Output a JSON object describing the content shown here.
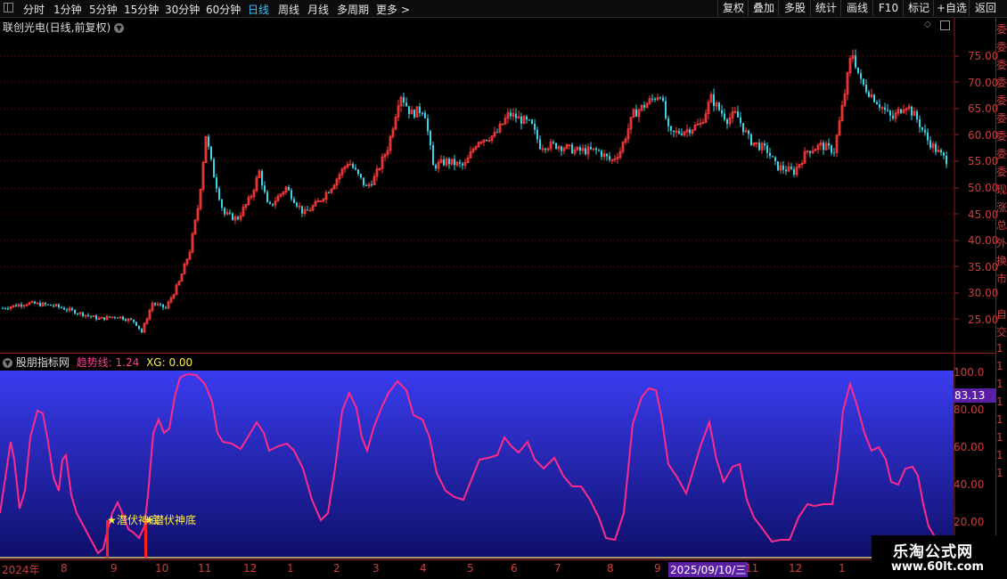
{
  "toolbar": {
    "periods": [
      "分时",
      "1分钟",
      "5分钟",
      "15分钟",
      "30分钟",
      "60分钟",
      "日线",
      "周线",
      "月线",
      "多周期",
      "更多 >"
    ],
    "active_period": "日线",
    "right_buttons": [
      "复权",
      "叠加",
      "多股",
      "统计",
      "画线",
      "F10",
      "标记",
      "+自选",
      "返回"
    ]
  },
  "main_panel": {
    "title": "联创光电(日线,前复权)",
    "y_ticks": [
      "75.00",
      "70.00",
      "65.00",
      "60.00",
      "55.00",
      "50.00",
      "45.00",
      "40.00",
      "35.00",
      "30.00",
      "25.00"
    ]
  },
  "indicator_panel": {
    "title": "股朋指标网",
    "trend_label": "趋势线: 1.24",
    "xg_label": "XG: 0.00",
    "current_value": "83.13",
    "y_ticks": [
      "100.0",
      "80.00",
      "60.00",
      "40.00",
      "20.00"
    ],
    "signal_label": "潜伏神底",
    "colors": {
      "line": "#ff2a8a",
      "bg_top": "#3a3cf0",
      "bg_bottom": "#0e0f6a",
      "signal": "#ffee44"
    }
  },
  "x_axis": {
    "labels": [
      "2024年",
      "8",
      "9",
      "10",
      "11",
      "12",
      "1",
      "2",
      "3",
      "4",
      "5",
      "6",
      "7",
      "8",
      "9",
      "2025/09/10/三",
      "11",
      "12",
      "1"
    ]
  },
  "right_strip": [
    "委",
    "委",
    "委",
    "委",
    "委",
    "委",
    "委",
    "委",
    "委",
    "现",
    "涨",
    "总",
    "外",
    "换",
    "市",
    "自",
    "交",
    "1",
    "1",
    "1",
    "1",
    "1",
    "1",
    "1",
    "1"
  ],
  "watermark": {
    "name": "乐淘公式网",
    "url": "www.60lt.com"
  }
}
